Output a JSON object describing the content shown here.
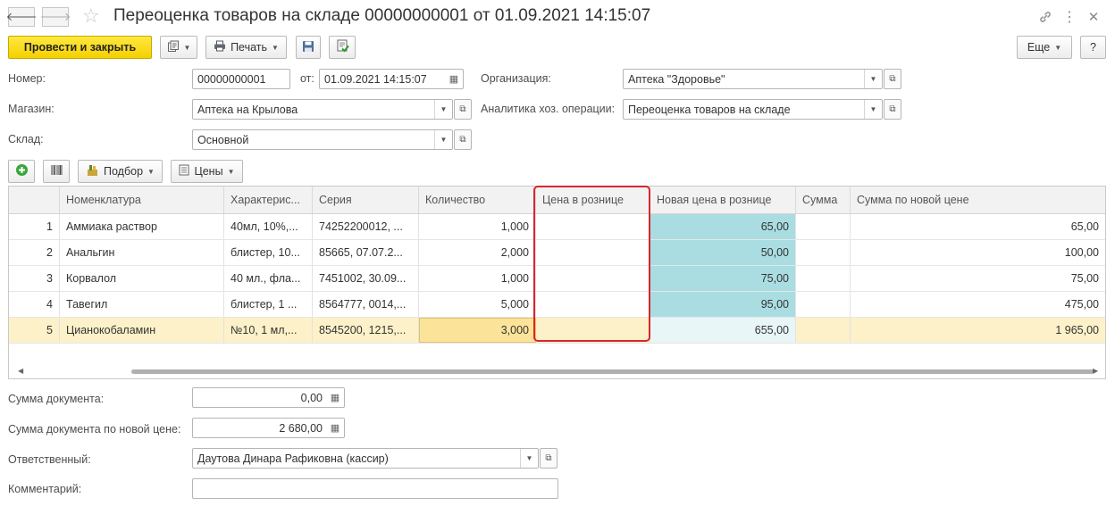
{
  "window": {
    "title": "Переоценка товаров на складе 00000000001 от 01.09.2021 14:15:07",
    "icons": [
      "back-arrow-icon",
      "forward-arrow-icon",
      "star-icon",
      "link-icon",
      "more-icon",
      "close-icon"
    ]
  },
  "toolbar": {
    "post_close": "Провести и закрыть",
    "print": "Печать",
    "more": "Еще",
    "help": "?"
  },
  "form": {
    "number_label": "Номер:",
    "number": "00000000001",
    "from_label": "от:",
    "date": "01.09.2021 14:15:07",
    "org_label": "Организация:",
    "org": "Аптека \"Здоровье\"",
    "store_label": "Магазин:",
    "store": "Аптека на Крылова",
    "analytics_label": "Аналитика хоз. операции:",
    "analytics": "Переоценка товаров на складе",
    "warehouse_label": "Склад:",
    "warehouse": "Основной"
  },
  "table_toolbar": {
    "pick": "Подбор",
    "prices": "Цены"
  },
  "table": {
    "columns": [
      "",
      "Номенклатура",
      "Характерис...",
      "Серия",
      "Количество",
      "Цена в рознице",
      "Новая цена в рознице",
      "Сумма",
      "Сумма по новой цене"
    ],
    "rows": [
      {
        "n": "1",
        "name": "Аммиака раствор",
        "char": "40мл, 10%,...",
        "series": "74252200012, ...",
        "qty": "1,000",
        "price": "",
        "new_price": "65,00",
        "sum": "",
        "new_sum": "65,00"
      },
      {
        "n": "2",
        "name": "Анальгин",
        "char": "блистер, 10...",
        "series": "85665, 07.07.2...",
        "qty": "2,000",
        "price": "",
        "new_price": "50,00",
        "sum": "",
        "new_sum": "100,00"
      },
      {
        "n": "3",
        "name": "Корвалол",
        "char": "40 мл., фла...",
        "series": "7451002, 30.09...",
        "qty": "1,000",
        "price": "",
        "new_price": "75,00",
        "sum": "",
        "new_sum": "75,00"
      },
      {
        "n": "4",
        "name": "Тавегил",
        "char": "блистер, 1 ...",
        "series": "8564777, 0014,...",
        "qty": "5,000",
        "price": "",
        "new_price": "95,00",
        "sum": "",
        "new_sum": "475,00"
      },
      {
        "n": "5",
        "name": "Цианокобаламин",
        "char": "№10, 1 мл,...",
        "series": "8545200, 1215,...",
        "qty": "3,000",
        "price": "",
        "new_price": "655,00",
        "sum": "",
        "new_sum": "1 965,00"
      }
    ]
  },
  "footer": {
    "doc_sum_label": "Сумма документа:",
    "doc_sum": "0,00",
    "doc_new_sum_label": "Сумма документа по новой цене:",
    "doc_new_sum": "2 680,00",
    "responsible_label": "Ответственный:",
    "responsible": "Даутова Динара Рафиковна (кассир)",
    "comment_label": "Комментарий:",
    "comment": ""
  }
}
